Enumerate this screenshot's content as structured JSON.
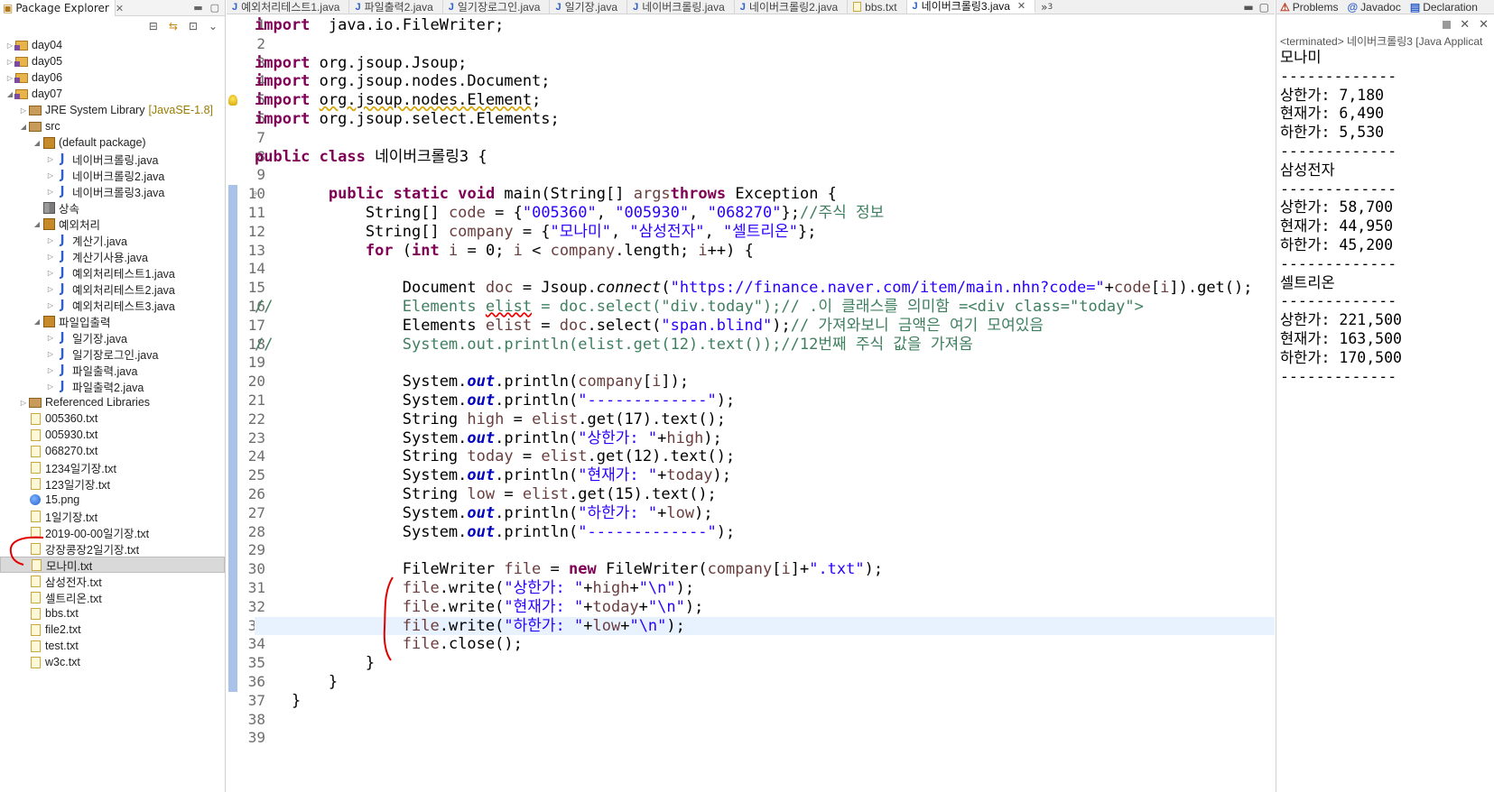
{
  "explorer": {
    "title": "Package Explorer",
    "tree": [
      {
        "label": "day04",
        "type": "project",
        "depth": 0,
        "arrow": "closed"
      },
      {
        "label": "day05",
        "type": "project",
        "depth": 0,
        "arrow": "closed"
      },
      {
        "label": "day06",
        "type": "project",
        "depth": 0,
        "arrow": "closed"
      },
      {
        "label": "day07",
        "type": "project",
        "depth": 0,
        "arrow": "open"
      },
      {
        "label": "JRE System Library",
        "deco": "[JavaSE-1.8]",
        "type": "library",
        "depth": 1,
        "arrow": "closed"
      },
      {
        "label": "src",
        "type": "srcfolder",
        "depth": 1,
        "arrow": "open"
      },
      {
        "label": "(default package)",
        "type": "package",
        "depth": 2,
        "arrow": "open"
      },
      {
        "label": "네이버크롤링.java",
        "type": "java",
        "depth": 3,
        "arrow": "closed"
      },
      {
        "label": "네이버크롤링2.java",
        "type": "java",
        "depth": 3,
        "arrow": "closed"
      },
      {
        "label": "네이버크롤링3.java",
        "type": "java",
        "depth": 3,
        "arrow": "closed"
      },
      {
        "label": "상속",
        "type": "package-empty",
        "depth": 2,
        "arrow": "none"
      },
      {
        "label": "예외처리",
        "type": "package",
        "depth": 2,
        "arrow": "open"
      },
      {
        "label": "계산기.java",
        "type": "java",
        "depth": 3,
        "arrow": "closed"
      },
      {
        "label": "계산기사용.java",
        "type": "java",
        "depth": 3,
        "arrow": "closed"
      },
      {
        "label": "예외처리테스트1.java",
        "type": "java",
        "depth": 3,
        "arrow": "closed"
      },
      {
        "label": "예외처리테스트2.java",
        "type": "java",
        "depth": 3,
        "arrow": "closed"
      },
      {
        "label": "예외처리테스트3.java",
        "type": "java",
        "depth": 3,
        "arrow": "closed"
      },
      {
        "label": "파일입출력",
        "type": "package",
        "depth": 2,
        "arrow": "open"
      },
      {
        "label": "일기장.java",
        "type": "java",
        "depth": 3,
        "arrow": "closed"
      },
      {
        "label": "일기장로그인.java",
        "type": "java",
        "depth": 3,
        "arrow": "closed"
      },
      {
        "label": "파일출력.java",
        "type": "java",
        "depth": 3,
        "arrow": "closed"
      },
      {
        "label": "파일출력2.java",
        "type": "java",
        "depth": 3,
        "arrow": "closed"
      },
      {
        "label": "Referenced Libraries",
        "type": "library",
        "depth": 1,
        "arrow": "closed"
      },
      {
        "label": "005360.txt",
        "type": "txt",
        "depth": 1,
        "arrow": "none"
      },
      {
        "label": "005930.txt",
        "type": "txt",
        "depth": 1,
        "arrow": "none"
      },
      {
        "label": "068270.txt",
        "type": "txt",
        "depth": 1,
        "arrow": "none"
      },
      {
        "label": "1234일기장.txt",
        "type": "txt",
        "depth": 1,
        "arrow": "none"
      },
      {
        "label": "123일기장.txt",
        "type": "txt",
        "depth": 1,
        "arrow": "none"
      },
      {
        "label": "15.png",
        "type": "png",
        "depth": 1,
        "arrow": "none"
      },
      {
        "label": "1일기장.txt",
        "type": "txt",
        "depth": 1,
        "arrow": "none"
      },
      {
        "label": "2019-00-00일기장.txt",
        "type": "txt",
        "depth": 1,
        "arrow": "none"
      },
      {
        "label": "강장콩장2일기장.txt",
        "type": "txt",
        "depth": 1,
        "arrow": "none"
      },
      {
        "label": "모나미.txt",
        "type": "txt",
        "depth": 1,
        "arrow": "none",
        "selected": true
      },
      {
        "label": "삼성전자.txt",
        "type": "txt",
        "depth": 1,
        "arrow": "none"
      },
      {
        "label": "셀트리온.txt",
        "type": "txt",
        "depth": 1,
        "arrow": "none"
      },
      {
        "label": "bbs.txt",
        "type": "txt",
        "depth": 1,
        "arrow": "none"
      },
      {
        "label": "file2.txt",
        "type": "txt",
        "depth": 1,
        "arrow": "none"
      },
      {
        "label": "test.txt",
        "type": "txt",
        "depth": 1,
        "arrow": "none"
      },
      {
        "label": "w3c.txt",
        "type": "txt",
        "depth": 1,
        "arrow": "none"
      }
    ]
  },
  "editor": {
    "tabs": [
      {
        "label": "예외처리테스트1.java",
        "icon": "java"
      },
      {
        "label": "파일출력2.java",
        "icon": "java"
      },
      {
        "label": "일기장로그인.java",
        "icon": "java"
      },
      {
        "label": "일기장.java",
        "icon": "java"
      },
      {
        "label": "네이버크롤링.java",
        "icon": "java"
      },
      {
        "label": "네이버크롤링2.java",
        "icon": "java"
      },
      {
        "label": "bbs.txt",
        "icon": "txt"
      },
      {
        "label": "네이버크롤링3.java",
        "icon": "java",
        "active": true
      }
    ],
    "overflow_count": "3",
    "current_line": 33,
    "lines": [
      [
        [
          "kw",
          "import"
        ],
        [
          "",
          "  java.io.FileWriter;"
        ]
      ],
      [],
      [
        [
          "kw",
          "import"
        ],
        [
          "",
          " org.jsoup.Jsoup;"
        ]
      ],
      [
        [
          "kw",
          "import"
        ],
        [
          "",
          " org.jsoup.nodes.Document;"
        ]
      ],
      [
        [
          "kw",
          "import"
        ],
        [
          "",
          " "
        ],
        [
          "warn",
          "org.jsoup.nodes.Element"
        ],
        [
          "",
          ";"
        ]
      ],
      [
        [
          "kw",
          "import"
        ],
        [
          "",
          " org.jsoup.select.Elements;"
        ]
      ],
      [],
      [
        [
          "kw",
          "public"
        ],
        [
          "",
          " "
        ],
        [
          "kw",
          "class"
        ],
        [
          "",
          " 네이버크롤링3 {"
        ]
      ],
      [],
      [
        [
          "",
          "        "
        ],
        [
          "kw",
          "public"
        ],
        [
          "",
          " "
        ],
        [
          "kw",
          "static"
        ],
        [
          "",
          " "
        ],
        [
          "kw",
          "void"
        ],
        [
          "",
          " main(String[] "
        ],
        [
          "var",
          "args"
        ],
        [
          ") "
        ],
        [
          "kw",
          "throws"
        ],
        [
          "",
          " Exception {"
        ]
      ],
      [
        [
          "",
          "            String[] "
        ],
        [
          "var",
          "code"
        ],
        [
          "",
          " = {"
        ],
        [
          "str",
          "\"005360\""
        ],
        [
          "",
          ", "
        ],
        [
          "str",
          "\"005930\""
        ],
        [
          "",
          ", "
        ],
        [
          "str",
          "\"068270\""
        ],
        [
          "",
          "};"
        ],
        [
          "cm",
          "//주식 정보"
        ]
      ],
      [
        [
          "",
          "            String[] "
        ],
        [
          "var",
          "company"
        ],
        [
          "",
          " = {"
        ],
        [
          "str",
          "\"모나미\""
        ],
        [
          "",
          ", "
        ],
        [
          "str",
          "\"삼성전자\""
        ],
        [
          "",
          ", "
        ],
        [
          "str",
          "\"셀트리온\""
        ],
        [
          "",
          "};"
        ]
      ],
      [
        [
          "",
          "            "
        ],
        [
          "kw",
          "for"
        ],
        [
          "",
          " ("
        ],
        [
          "kw",
          "int"
        ],
        [
          "",
          " "
        ],
        [
          "var",
          "i"
        ],
        [
          "",
          " = 0; "
        ],
        [
          "var",
          "i"
        ],
        [
          "",
          " < "
        ],
        [
          "var",
          "company"
        ],
        [
          "",
          ".length; "
        ],
        [
          "var",
          "i"
        ],
        [
          "",
          "++) {"
        ]
      ],
      [],
      [
        [
          "",
          "                Document "
        ],
        [
          "var",
          "doc"
        ],
        [
          "",
          " = Jsoup."
        ],
        [
          "it",
          "connect"
        ],
        [
          "",
          "("
        ],
        [
          "str",
          "\"https://finance.naver.com/item/main.nhn?code=\""
        ],
        [
          "",
          "+"
        ],
        [
          "var",
          "code"
        ],
        [
          "",
          "["
        ],
        [
          "var",
          "i"
        ],
        [
          "",
          "]).get();"
        ]
      ],
      [
        [
          "cm",
          "//              Elements "
        ],
        [
          "cm err",
          "elist"
        ],
        [
          "cm",
          " = doc.select(\"div.today\");// .이 클래스를 의미함 =<div class=\"today\">"
        ]
      ],
      [
        [
          "",
          "                Elements "
        ],
        [
          "var",
          "elist"
        ],
        [
          "",
          " = "
        ],
        [
          "var",
          "doc"
        ],
        [
          "",
          ".select("
        ],
        [
          "str",
          "\"span.blind\""
        ],
        [
          "",
          ");"
        ],
        [
          "cm",
          "// 가져와보니 금액은 여기 모여있음"
        ]
      ],
      [
        [
          "cm",
          "//              System.out.println(elist.get(12).text());//12번째 주식 값을 가져옴"
        ]
      ],
      [],
      [
        [
          "",
          "                System."
        ],
        [
          "fld",
          "out"
        ],
        [
          "",
          ".println("
        ],
        [
          "var",
          "company"
        ],
        [
          "",
          "["
        ],
        [
          "var",
          "i"
        ],
        [
          "",
          "]);"
        ]
      ],
      [
        [
          "",
          "                System."
        ],
        [
          "fld",
          "out"
        ],
        [
          "",
          ".println("
        ],
        [
          "str",
          "\"-------------\""
        ],
        [
          "",
          ");"
        ]
      ],
      [
        [
          "",
          "                String "
        ],
        [
          "var",
          "high"
        ],
        [
          "",
          " = "
        ],
        [
          "var",
          "elist"
        ],
        [
          "",
          ".get(17).text();"
        ]
      ],
      [
        [
          "",
          "                System."
        ],
        [
          "fld",
          "out"
        ],
        [
          "",
          ".println("
        ],
        [
          "str",
          "\"상한가: \""
        ],
        [
          "",
          "+"
        ],
        [
          "var",
          "high"
        ],
        [
          "",
          ");"
        ]
      ],
      [
        [
          "",
          "                String "
        ],
        [
          "var",
          "today"
        ],
        [
          "",
          " = "
        ],
        [
          "var",
          "elist"
        ],
        [
          "",
          ".get(12).text();"
        ]
      ],
      [
        [
          "",
          "                System."
        ],
        [
          "fld",
          "out"
        ],
        [
          "",
          ".println("
        ],
        [
          "str",
          "\"현재가: \""
        ],
        [
          "",
          "+"
        ],
        [
          "var",
          "today"
        ],
        [
          "",
          ");"
        ]
      ],
      [
        [
          "",
          "                String "
        ],
        [
          "var",
          "low"
        ],
        [
          "",
          " = "
        ],
        [
          "var",
          "elist"
        ],
        [
          "",
          ".get(15).text();"
        ]
      ],
      [
        [
          "",
          "                System."
        ],
        [
          "fld",
          "out"
        ],
        [
          "",
          ".println("
        ],
        [
          "str",
          "\"하한가: \""
        ],
        [
          "",
          "+"
        ],
        [
          "var",
          "low"
        ],
        [
          "",
          ");"
        ]
      ],
      [
        [
          "",
          "                System."
        ],
        [
          "fld",
          "out"
        ],
        [
          "",
          ".println("
        ],
        [
          "str",
          "\"-------------\""
        ],
        [
          "",
          ");"
        ]
      ],
      [],
      [
        [
          "",
          "                FileWriter "
        ],
        [
          "var",
          "file"
        ],
        [
          "",
          " = "
        ],
        [
          "kw",
          "new"
        ],
        [
          "",
          " FileWriter("
        ],
        [
          "var",
          "company"
        ],
        [
          "",
          "["
        ],
        [
          "var",
          "i"
        ],
        [
          "",
          "]+"
        ],
        [
          "str",
          "\".txt\""
        ],
        [
          "",
          ");"
        ]
      ],
      [
        [
          "",
          "                "
        ],
        [
          "var",
          "file"
        ],
        [
          "",
          ".write("
        ],
        [
          "str",
          "\"상한가: \""
        ],
        [
          "",
          "+"
        ],
        [
          "var",
          "high"
        ],
        [
          "",
          "+"
        ],
        [
          "str",
          "\"\\n\""
        ],
        [
          "",
          ");"
        ]
      ],
      [
        [
          "",
          "                "
        ],
        [
          "var",
          "file"
        ],
        [
          "",
          ".write("
        ],
        [
          "str",
          "\"현재가: \""
        ],
        [
          "",
          "+"
        ],
        [
          "var",
          "today"
        ],
        [
          "",
          "+"
        ],
        [
          "str",
          "\"\\n\""
        ],
        [
          "",
          ");"
        ]
      ],
      [
        [
          "",
          "                "
        ],
        [
          "var",
          "file"
        ],
        [
          "",
          ".write("
        ],
        [
          "str",
          "\"하한가: \""
        ],
        [
          "",
          "+"
        ],
        [
          "var",
          "low"
        ],
        [
          "",
          "+"
        ],
        [
          "str",
          "\"\\n\""
        ],
        [
          "",
          ");"
        ]
      ],
      [
        [
          "",
          "                "
        ],
        [
          "var",
          "file"
        ],
        [
          "",
          ".close();"
        ]
      ],
      [
        [
          "",
          "            }"
        ]
      ],
      [
        [
          "",
          "        }"
        ]
      ],
      [
        [
          "",
          "    }"
        ]
      ],
      [],
      []
    ]
  },
  "right": {
    "tabs": [
      {
        "label": "Problems",
        "icon": "problems"
      },
      {
        "label": "Javadoc",
        "icon": "at"
      },
      {
        "label": "Declaration",
        "icon": "decl"
      }
    ],
    "terminated": "<terminated> 네이버크롤링3 [Java Applicat",
    "console": [
      "모나미",
      "-------------",
      "상한가: 7,180",
      "현재가: 6,490",
      "하한가: 5,530",
      "-------------",
      "삼성전자",
      "-------------",
      "상한가: 58,700",
      "현재가: 44,950",
      "하한가: 45,200",
      "-------------",
      "셀트리온",
      "-------------",
      "상한가: 221,500",
      "현재가: 163,500",
      "하한가: 170,500",
      "-------------"
    ]
  }
}
